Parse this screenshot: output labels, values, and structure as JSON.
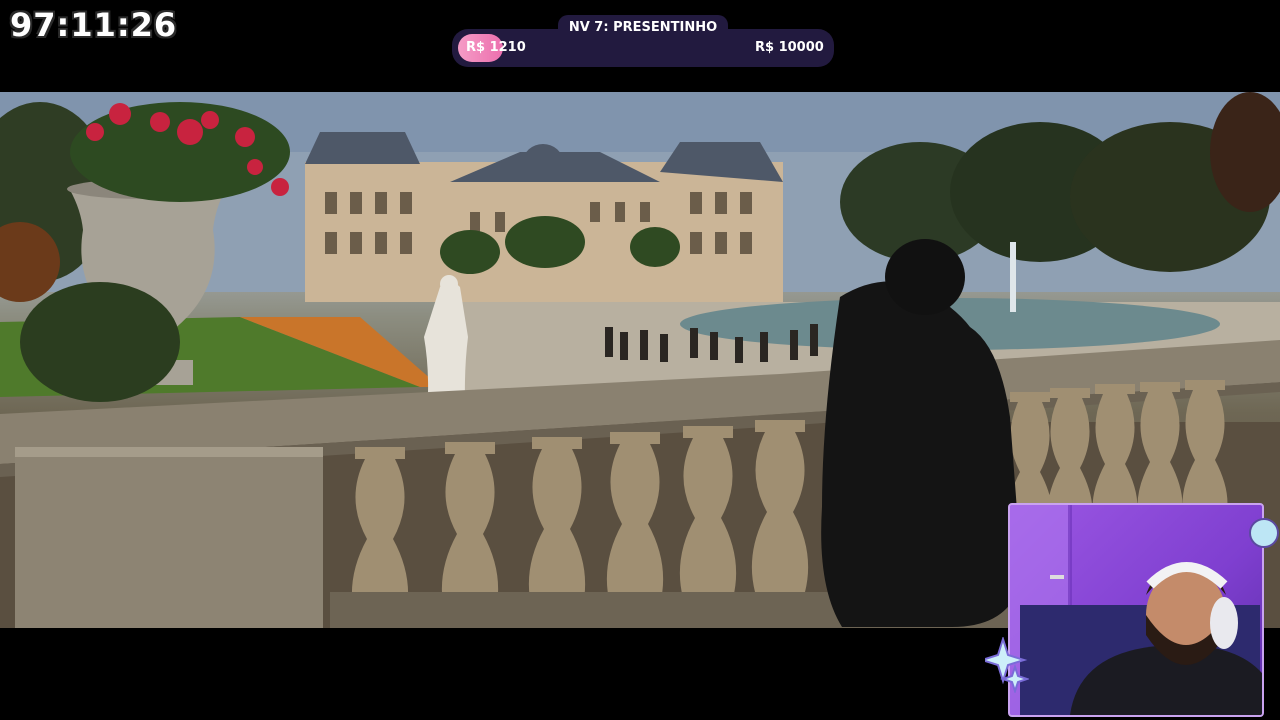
{
  "timer": {
    "text": "97:11:26"
  },
  "goal": {
    "title": "NV 7: PRESENTINHO",
    "current": "R$ 1210",
    "target": "R$ 10000",
    "progress": 0.121,
    "accent": "#ec6fae",
    "bar_color": "#221a3f"
  },
  "video": {
    "scene": "garden-palace-scene"
  },
  "webcam": {
    "background": "#8e4ce0"
  },
  "icons": [
    "emote-icon",
    "sparkle-icon"
  ]
}
